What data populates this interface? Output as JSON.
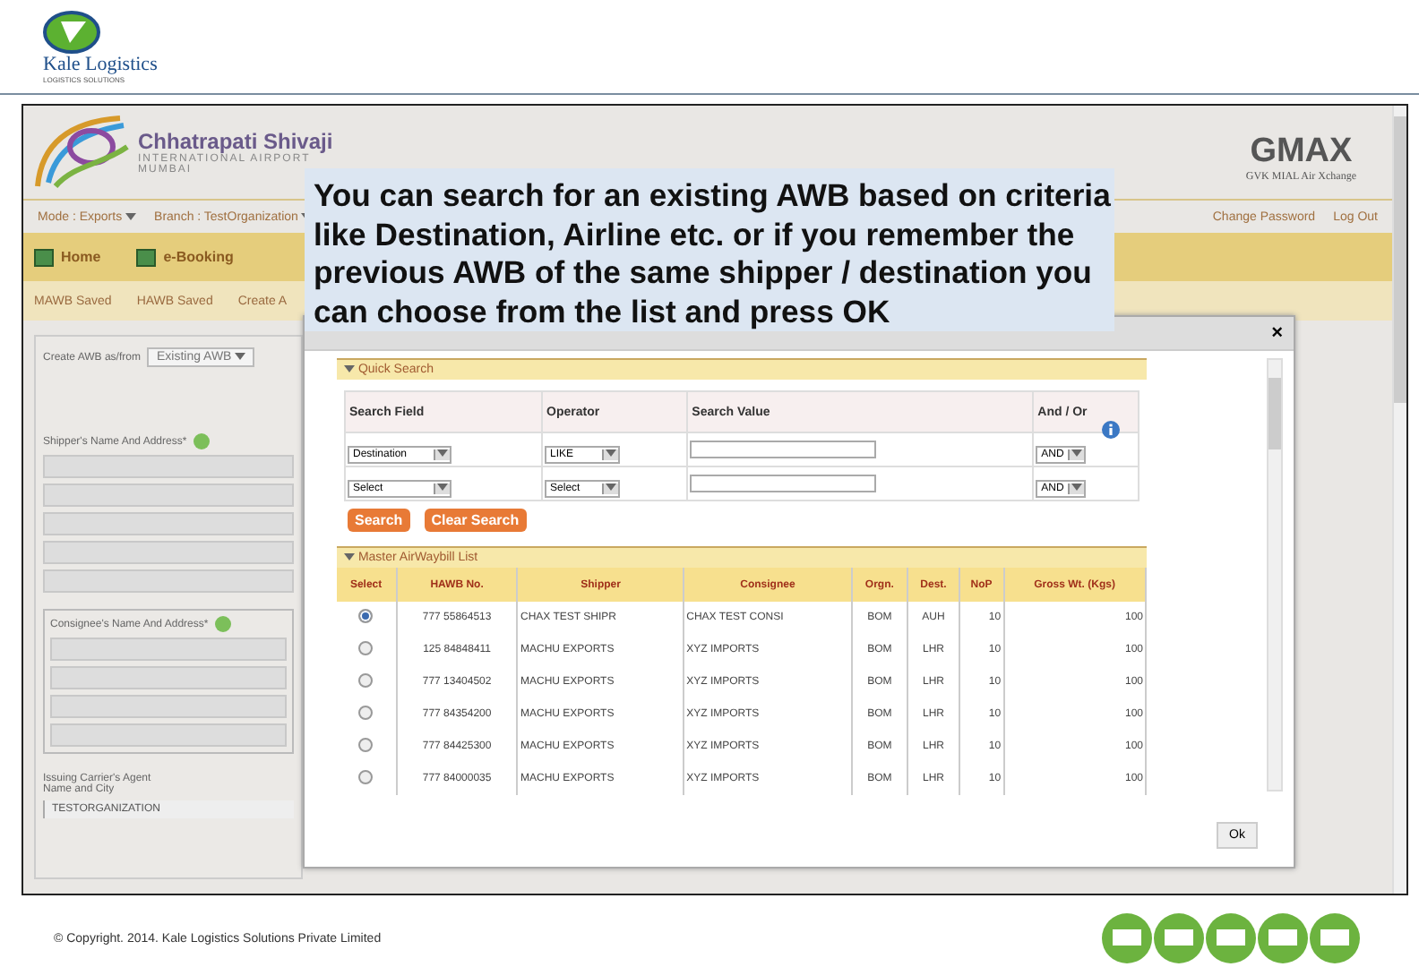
{
  "slide": {
    "logo_text": "Kale Logistics",
    "logo_sub": "LOGISTICS SOLUTIONS",
    "footer": "© Copyright. 2014. Kale Logistics Solutions Private Limited"
  },
  "app": {
    "airport_name": "Chhatrapati Shivaji",
    "airport_sub": "INTERNATIONAL AIRPORT",
    "city": "MUMBAI",
    "brand": "GMAX",
    "brand_sub": "GVK MIAL Air Xchange",
    "mode": "Mode : Exports",
    "branch": "Branch : TestOrganization",
    "links": [
      "Change Password",
      "Log Out"
    ],
    "nav": [
      {
        "label": "Home"
      },
      {
        "label": "e-Booking"
      }
    ],
    "subnav": [
      "MAWB Saved",
      "HAWB Saved",
      "Create A"
    ],
    "form": {
      "create_label": "Create AWB as/from",
      "create_value": "Existing AWB",
      "shipper_label": "Shipper's Name And Address*",
      "consignee_label": "Consignee's Name And Address*",
      "agent_label": "Issuing Carrier's Agent Name and City",
      "agent_value": "TESTORGANIZATION"
    }
  },
  "callout": {
    "text": "You can search for an existing AWB based on criteria like Destination, Airline etc. or if you remember the previous AWB of the same shipper / destination you can choose from the list and press OK"
  },
  "dialog": {
    "close": "×",
    "quick_search": {
      "title": "Quick Search",
      "columns": [
        "Search Field",
        "Operator",
        "Search Value",
        "And / Or"
      ],
      "rows": [
        {
          "field": "Destination",
          "operator": "LIKE",
          "andor": "AND"
        },
        {
          "field": "Select",
          "operator": "Select",
          "andor": "AND"
        }
      ],
      "buttons": [
        "Search",
        "Clear Search"
      ]
    },
    "list": {
      "title": "Master AirWaybill List",
      "columns": [
        "Select",
        "HAWB No.",
        "Shipper",
        "Consignee",
        "Orgn.",
        "Dest.",
        "NoP",
        "Gross Wt. (Kgs)"
      ],
      "rows": [
        {
          "selected": true,
          "cells": [
            "",
            "777 55864513",
            "CHAX TEST SHIPR",
            "CHAX TEST CONSI",
            "BOM",
            "AUH",
            "10",
            "100"
          ]
        },
        {
          "selected": false,
          "cells": [
            "",
            "125 84848411",
            "MACHU EXPORTS",
            "XYZ IMPORTS",
            "BOM",
            "LHR",
            "10",
            "100"
          ]
        },
        {
          "selected": false,
          "cells": [
            "",
            "777 13404502",
            "MACHU EXPORTS",
            "XYZ IMPORTS",
            "BOM",
            "LHR",
            "10",
            "100"
          ]
        },
        {
          "selected": false,
          "cells": [
            "",
            "777 84354200",
            "MACHU EXPORTS",
            "XYZ IMPORTS",
            "BOM",
            "LHR",
            "10",
            "100"
          ]
        },
        {
          "selected": false,
          "cells": [
            "",
            "777 84425300",
            "MACHU EXPORTS",
            "XYZ IMPORTS",
            "BOM",
            "LHR",
            "10",
            "100"
          ]
        },
        {
          "selected": false,
          "cells": [
            "",
            "777 84000035",
            "MACHU EXPORTS",
            "XYZ IMPORTS",
            "BOM",
            "LHR",
            "10",
            "100"
          ]
        }
      ]
    },
    "ok": "Ok"
  }
}
